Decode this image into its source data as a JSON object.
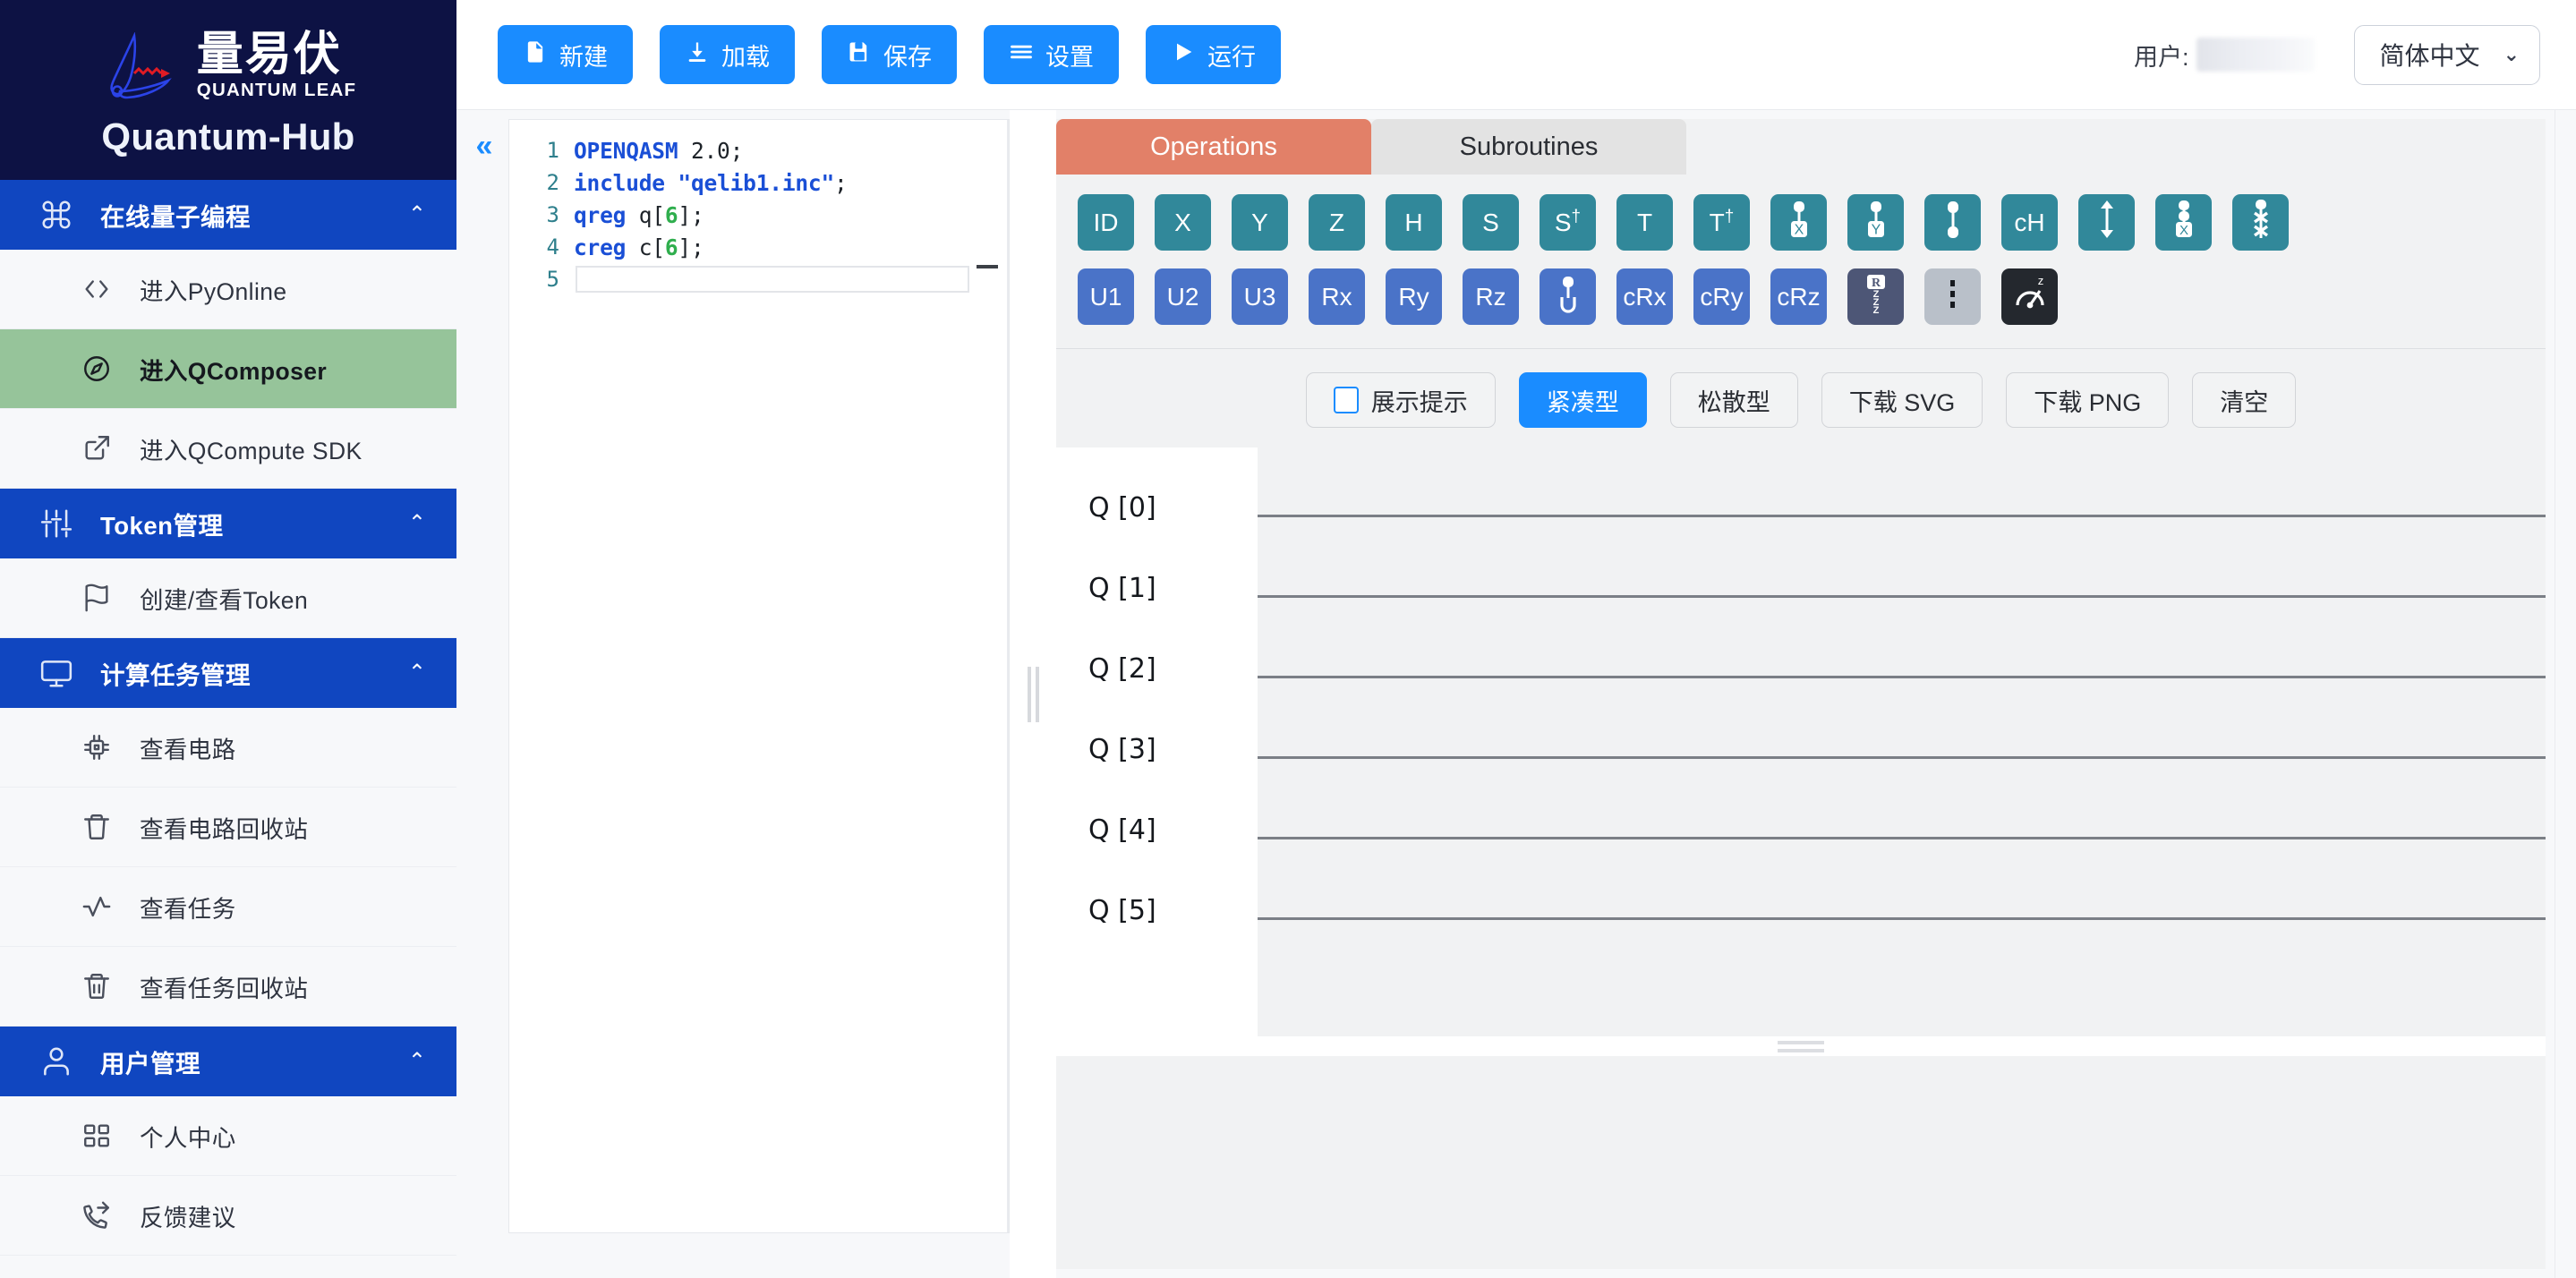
{
  "brand": {
    "cn_name": "量易伏",
    "cn_sub": "QUANTUM LEAF",
    "title": "Quantum-Hub",
    "logo_icon": "quantum-leaf-logo"
  },
  "sidebar": {
    "groups": [
      {
        "label": "在线量子编程",
        "icon": "command-icon",
        "chevron": "⌃",
        "items": [
          {
            "label": "进入PyOnline",
            "icon": "code-brackets-icon",
            "active": false
          },
          {
            "label": "进入QComposer",
            "icon": "compass-icon",
            "active": true
          },
          {
            "label": "进入QCompute SDK",
            "icon": "external-link-icon",
            "active": false
          }
        ]
      },
      {
        "label": "Token管理",
        "icon": "sliders-icon",
        "chevron": "⌃",
        "items": [
          {
            "label": "创建/查看Token",
            "icon": "flag-icon",
            "active": false
          }
        ]
      },
      {
        "label": "计算任务管理",
        "icon": "monitor-icon",
        "chevron": "⌃",
        "items": [
          {
            "label": "查看电路",
            "icon": "chip-icon",
            "active": false
          },
          {
            "label": "查看电路回收站",
            "icon": "trash-icon",
            "active": false
          },
          {
            "label": "查看任务",
            "icon": "activity-icon",
            "active": false
          },
          {
            "label": "查看任务回收站",
            "icon": "trash-bin-icon",
            "active": false
          }
        ]
      },
      {
        "label": "用户管理",
        "icon": "user-icon",
        "chevron": "⌃",
        "items": [
          {
            "label": "个人中心",
            "icon": "grid-icon",
            "active": false
          },
          {
            "label": "反馈建议",
            "icon": "phone-forwarded-icon",
            "active": false
          }
        ]
      }
    ]
  },
  "topbar": {
    "buttons": [
      {
        "label": "新建",
        "icon": "file-icon"
      },
      {
        "label": "加载",
        "icon": "download-icon"
      },
      {
        "label": "保存",
        "icon": "save-icon"
      },
      {
        "label": "设置",
        "icon": "menu-icon"
      },
      {
        "label": "运行",
        "icon": "play-icon"
      }
    ],
    "user_label": "用户:",
    "user_value": "",
    "language": {
      "selected": "简体中文",
      "chevron": "⌄"
    }
  },
  "editor": {
    "collapse_icon": "chevrons-left-icon",
    "lines": [
      {
        "no": "1",
        "tokens": [
          {
            "t": "kw",
            "v": "OPENQASM"
          },
          {
            "t": "plain",
            "v": " 2.0;"
          }
        ]
      },
      {
        "no": "2",
        "tokens": [
          {
            "t": "kw",
            "v": "include"
          },
          {
            "t": "plain",
            "v": " "
          },
          {
            "t": "str",
            "v": "\"qelib1.inc\""
          },
          {
            "t": "plain",
            "v": ";"
          }
        ]
      },
      {
        "no": "3",
        "tokens": [
          {
            "t": "kw",
            "v": "qreg"
          },
          {
            "t": "plain",
            "v": " q["
          },
          {
            "t": "num",
            "v": "6"
          },
          {
            "t": "plain",
            "v": "];"
          }
        ]
      },
      {
        "no": "4",
        "tokens": [
          {
            "t": "kw",
            "v": "creg"
          },
          {
            "t": "plain",
            "v": " c["
          },
          {
            "t": "num",
            "v": "6"
          },
          {
            "t": "plain",
            "v": "];"
          }
        ]
      },
      {
        "no": "5",
        "tokens": []
      }
    ]
  },
  "composer": {
    "tabs": [
      {
        "label": "Operations",
        "active": true
      },
      {
        "label": "Subroutines",
        "active": false
      }
    ],
    "gates_row1": [
      {
        "label": "ID",
        "style": "teal",
        "icon": ""
      },
      {
        "label": "X",
        "style": "teal",
        "icon": ""
      },
      {
        "label": "Y",
        "style": "teal",
        "icon": ""
      },
      {
        "label": "Z",
        "style": "teal",
        "icon": ""
      },
      {
        "label": "H",
        "style": "teal",
        "icon": ""
      },
      {
        "label": "S",
        "style": "teal",
        "icon": ""
      },
      {
        "label": "S†",
        "style": "teal",
        "icon": ""
      },
      {
        "label": "T",
        "style": "teal",
        "icon": ""
      },
      {
        "label": "T†",
        "style": "teal",
        "icon": ""
      },
      {
        "label": "",
        "style": "teal",
        "icon": "cnot-x-icon"
      },
      {
        "label": "",
        "style": "teal",
        "icon": "cnot-y-icon"
      },
      {
        "label": "",
        "style": "teal",
        "icon": "cz-icon"
      },
      {
        "label": "cH",
        "style": "teal",
        "icon": ""
      },
      {
        "label": "",
        "style": "teal",
        "icon": "swap-icon"
      },
      {
        "label": "",
        "style": "teal",
        "icon": "toffoli-icon"
      },
      {
        "label": "",
        "style": "teal",
        "icon": "fredkin-icon"
      }
    ],
    "gates_row2": [
      {
        "label": "U1",
        "style": "blue",
        "icon": ""
      },
      {
        "label": "U2",
        "style": "blue",
        "icon": ""
      },
      {
        "label": "U3",
        "style": "blue",
        "icon": ""
      },
      {
        "label": "Rx",
        "style": "blue",
        "icon": ""
      },
      {
        "label": "Ry",
        "style": "blue",
        "icon": ""
      },
      {
        "label": "Rz",
        "style": "blue",
        "icon": ""
      },
      {
        "label": "",
        "style": "blue",
        "icon": "cu-icon"
      },
      {
        "label": "cRx",
        "style": "blue",
        "icon": ""
      },
      {
        "label": "cRy",
        "style": "blue",
        "icon": ""
      },
      {
        "label": "cRz",
        "style": "blue",
        "icon": ""
      },
      {
        "label": "",
        "style": "slate",
        "icon": "rzz-icon"
      },
      {
        "label": "",
        "style": "grey",
        "icon": "barrier-icon"
      },
      {
        "label": "",
        "style": "dark",
        "icon": "measure-z-icon"
      }
    ],
    "options": [
      {
        "label": "展示提示",
        "kind": "checkbox"
      },
      {
        "label": "紧凑型",
        "kind": "primary"
      },
      {
        "label": "松散型",
        "kind": "normal"
      },
      {
        "label": "下载 SVG",
        "kind": "normal"
      },
      {
        "label": "下载 PNG",
        "kind": "normal"
      },
      {
        "label": "清空",
        "kind": "normal"
      }
    ],
    "qubits": [
      "Q [0]",
      "Q [1]",
      "Q [2]",
      "Q [3]",
      "Q [4]",
      "Q [5]"
    ]
  },
  "colors": {
    "brand_navy": "#0d1244",
    "nav_blue": "#1046c0",
    "accent_blue": "#1a8cff",
    "active_green": "#96c49a",
    "tab_salmon": "#e28068",
    "gate_teal": "#31889a",
    "gate_blue": "#4a73c8",
    "gate_slate": "#4d5676",
    "gate_grey": "#b9c0c9",
    "gate_dark": "#24282e"
  }
}
